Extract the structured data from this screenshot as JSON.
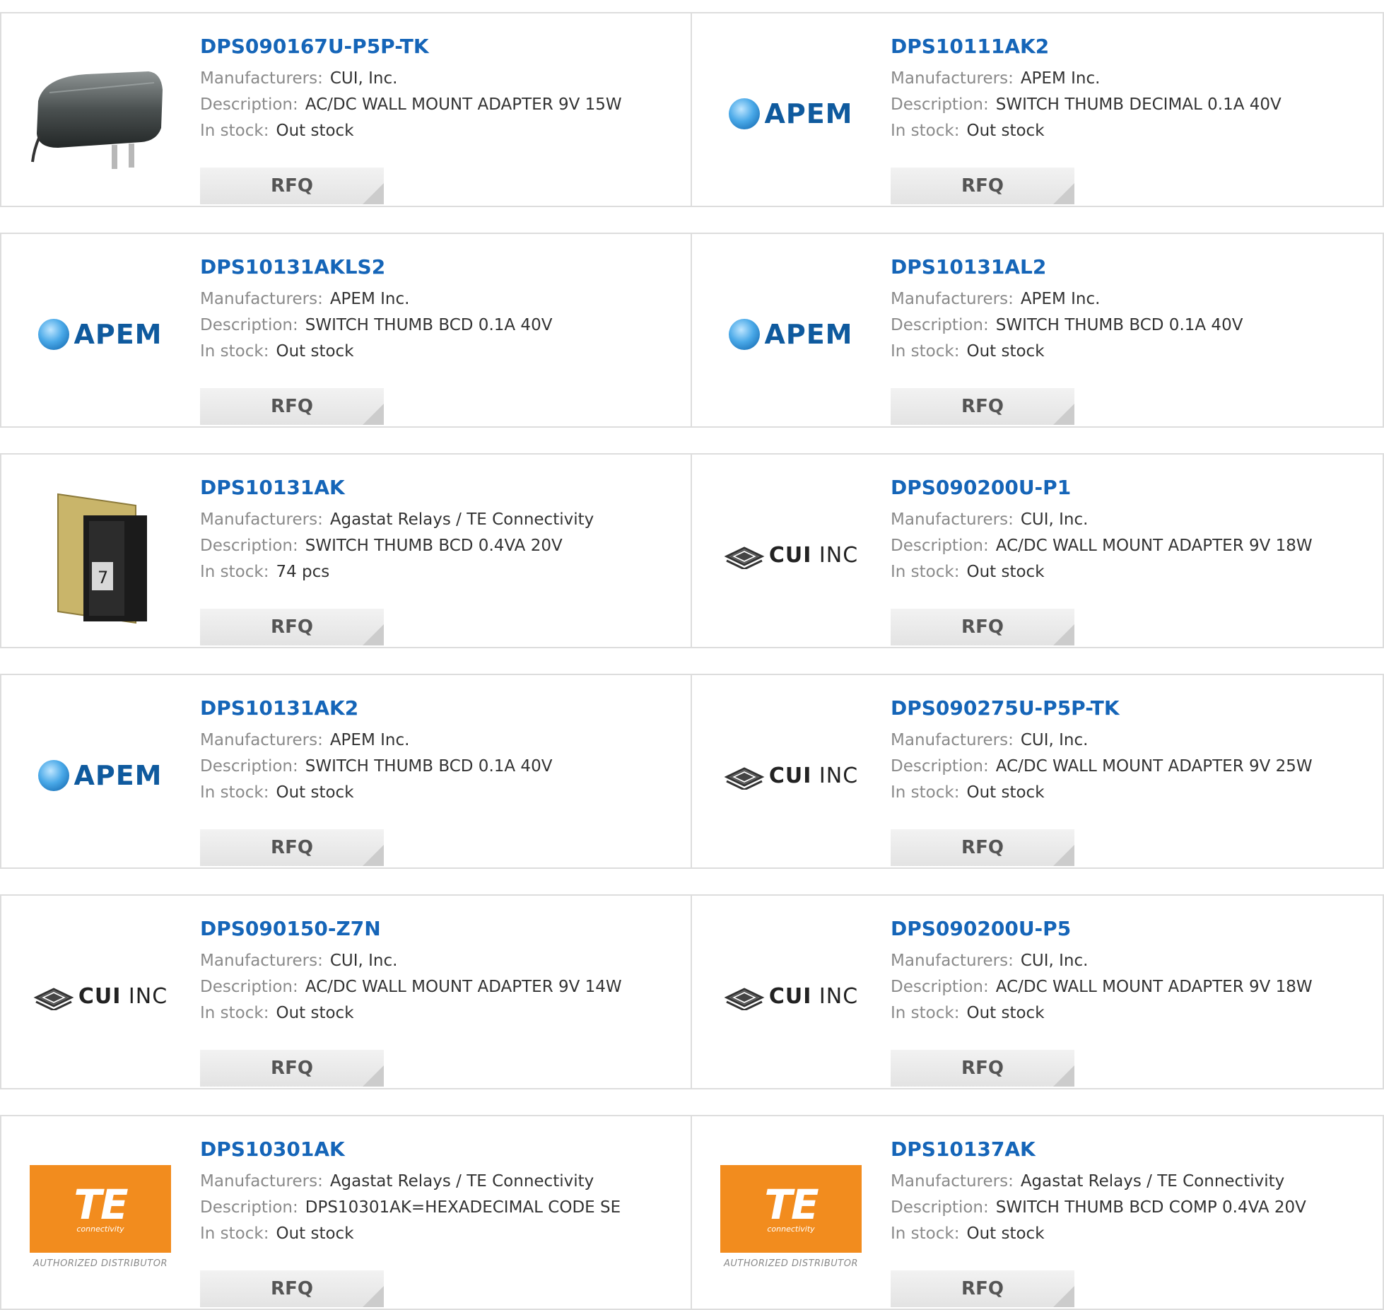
{
  "labels": {
    "manufacturer": "Manufacturers:",
    "description": "Description:",
    "stock": "In stock:",
    "rfq": "RFQ"
  },
  "logo_text": {
    "apem": "APEM",
    "cui_bold": "CUI",
    "cui_light": "INC",
    "te_mark": "TE",
    "te_sub": "connectivity",
    "te_auth": "AUTHORIZED DISTRIBUTOR"
  },
  "colors": {
    "part_link": "#1565b8",
    "label_gray": "#8a8a8a",
    "value_text": "#333333",
    "te_orange": "#f28c1e",
    "apem_blue": "#0f5a9e"
  },
  "products": [
    {
      "part": "DPS090167U-P5P-TK",
      "manufacturer": "CUI, Inc.",
      "description": "AC/DC WALL MOUNT ADAPTER 9V 15W",
      "stock": "Out stock",
      "image": "wall-adapter-photo"
    },
    {
      "part": "DPS10111AK2",
      "manufacturer": "APEM Inc.",
      "description": "SWITCH THUMB DECIMAL 0.1A 40V",
      "stock": "Out stock",
      "image": "apem-logo"
    },
    {
      "part": "DPS10131AKLS2",
      "manufacturer": "APEM Inc.",
      "description": "SWITCH THUMB BCD 0.1A 40V",
      "stock": "Out stock",
      "image": "apem-logo"
    },
    {
      "part": "DPS10131AL2",
      "manufacturer": "APEM Inc.",
      "description": "SWITCH THUMB BCD 0.1A 40V",
      "stock": "Out stock",
      "image": "apem-logo"
    },
    {
      "part": "DPS10131AK",
      "manufacturer": "Agastat Relays / TE Connectivity",
      "description": "SWITCH THUMB BCD 0.4VA 20V",
      "stock": "74 pcs",
      "image": "thumbwheel-switch-photo"
    },
    {
      "part": "DPS090200U-P1",
      "manufacturer": "CUI, Inc.",
      "description": "AC/DC WALL MOUNT ADAPTER 9V 18W",
      "stock": "Out stock",
      "image": "cui-logo"
    },
    {
      "part": "DPS10131AK2",
      "manufacturer": "APEM Inc.",
      "description": "SWITCH THUMB BCD 0.1A 40V",
      "stock": "Out stock",
      "image": "apem-logo"
    },
    {
      "part": "DPS090275U-P5P-TK",
      "manufacturer": "CUI, Inc.",
      "description": "AC/DC WALL MOUNT ADAPTER 9V 25W",
      "stock": "Out stock",
      "image": "cui-logo"
    },
    {
      "part": "DPS090150-Z7N",
      "manufacturer": "CUI, Inc.",
      "description": "AC/DC WALL MOUNT ADAPTER 9V 14W",
      "stock": "Out stock",
      "image": "cui-logo"
    },
    {
      "part": "DPS090200U-P5",
      "manufacturer": "CUI, Inc.",
      "description": "AC/DC WALL MOUNT ADAPTER 9V 18W",
      "stock": "Out stock",
      "image": "cui-logo"
    },
    {
      "part": "DPS10301AK",
      "manufacturer": "Agastat Relays / TE Connectivity",
      "description": "DPS10301AK=HEXADECIMAL CODE SE",
      "stock": "Out stock",
      "image": "te-logo"
    },
    {
      "part": "DPS10137AK",
      "manufacturer": "Agastat Relays / TE Connectivity",
      "description": "SWITCH THUMB BCD COMP 0.4VA 20V",
      "stock": "Out stock",
      "image": "te-logo"
    }
  ]
}
